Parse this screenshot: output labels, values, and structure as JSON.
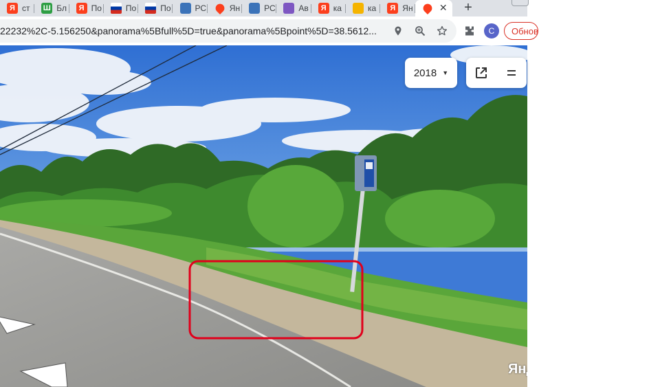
{
  "browser": {
    "tabs": [
      {
        "label": "ст",
        "favicon_icon": "yandex-icon",
        "favicon_glyph": "Я",
        "color": "#fc3f1d"
      },
      {
        "label": "Бл",
        "favicon_icon": "sheets-icon",
        "favicon_glyph": "Ш",
        "color": "#2e9e44"
      },
      {
        "label": "По",
        "favicon_icon": "yandex-icon",
        "favicon_glyph": "Я",
        "color": "#fc3f1d"
      },
      {
        "label": "По",
        "favicon_icon": "russia-flag-icon",
        "favicon_glyph": "",
        "color": "#0039a6"
      },
      {
        "label": "По",
        "favicon_icon": "russia-flag-icon",
        "favicon_glyph": "",
        "color": "#0039a6"
      },
      {
        "label": "РС",
        "favicon_icon": "airplane-icon",
        "favicon_glyph": "",
        "color": "#3b73b9"
      },
      {
        "label": "Ян",
        "favicon_icon": "map-pin-icon",
        "favicon_glyph": "",
        "color": "#fc3f1d"
      },
      {
        "label": "РС",
        "favicon_icon": "airplane-icon",
        "favicon_glyph": "",
        "color": "#3b73b9"
      },
      {
        "label": "Ав",
        "favicon_icon": "dots-icon",
        "favicon_glyph": "",
        "color": "#7e57c2"
      },
      {
        "label": "ка",
        "favicon_icon": "yandex-icon",
        "favicon_glyph": "Я",
        "color": "#fc3f1d"
      },
      {
        "label": "ка",
        "favicon_icon": "image-icon",
        "favicon_glyph": "",
        "color": "#f5b400"
      },
      {
        "label": "Ян",
        "favicon_icon": "yandex-icon",
        "favicon_glyph": "Я",
        "color": "#fc3f1d"
      },
      {
        "label": "",
        "favicon_icon": "map-pin-icon",
        "favicon_glyph": "",
        "color": "#fc3f1d",
        "active": true
      }
    ],
    "new_tab_label": "+",
    "url": "22232%2C-5.156250&panorama%5Bfull%5D=true&panorama%5Bpoint%5D=38.5612...",
    "profile_initial": "С",
    "update_button_label": "Обновить"
  },
  "panorama": {
    "year_label": "2018",
    "watermark": "Яндекс",
    "highlight_color": "#e0001b"
  }
}
